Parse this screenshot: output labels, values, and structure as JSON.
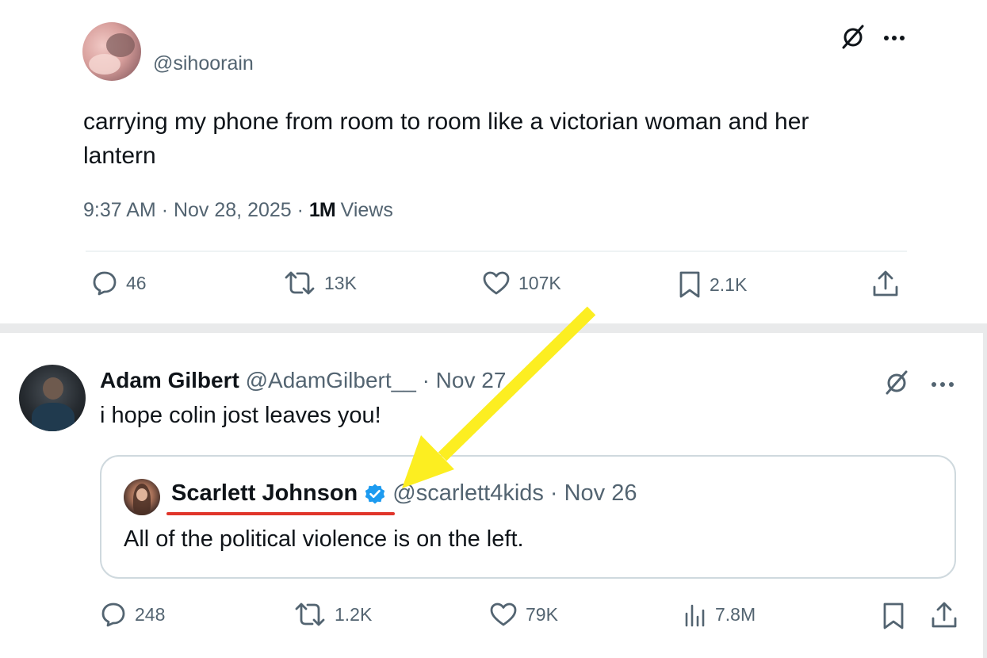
{
  "tweet1": {
    "handle": "@sihoorain",
    "text_line1": "carrying my phone from room to room like a victorian woman and her",
    "text_line2": "lantern",
    "time": "9:37 AM",
    "sep": "·",
    "date": "Nov 28, 2025",
    "views_count": "1M",
    "views_label": "Views",
    "actions": {
      "replies": "46",
      "reposts": "13K",
      "likes": "107K",
      "bookmarks": "2.1K"
    },
    "icons": [
      "grok-icon",
      "more-icon",
      "reply-icon",
      "repost-icon",
      "like-icon",
      "bookmark-icon",
      "share-icon"
    ]
  },
  "tweet2": {
    "name": "Adam Gilbert",
    "handle": "@AdamGilbert__",
    "sep": "·",
    "date": "Nov 27",
    "text": "i hope colin jost leaves you!",
    "quote": {
      "name": "Scarlett Johnson",
      "handle": "@scarlett4kids",
      "sep": "·",
      "date": "Nov 26",
      "text": "All of the political violence is on the left."
    },
    "actions": {
      "replies": "248",
      "reposts": "1.2K",
      "likes": "79K",
      "views": "7.8M"
    },
    "icons": [
      "grok-icon",
      "more-icon",
      "verified-badge-icon",
      "reply-icon",
      "repost-icon",
      "like-icon",
      "views-icon",
      "bookmark-icon",
      "share-icon"
    ]
  },
  "colors": {
    "text": "#0f1419",
    "muted": "#536471",
    "verified": "#1d9bf0",
    "annotation_arrow": "#fcee21",
    "annotation_underline": "#e0352b"
  }
}
